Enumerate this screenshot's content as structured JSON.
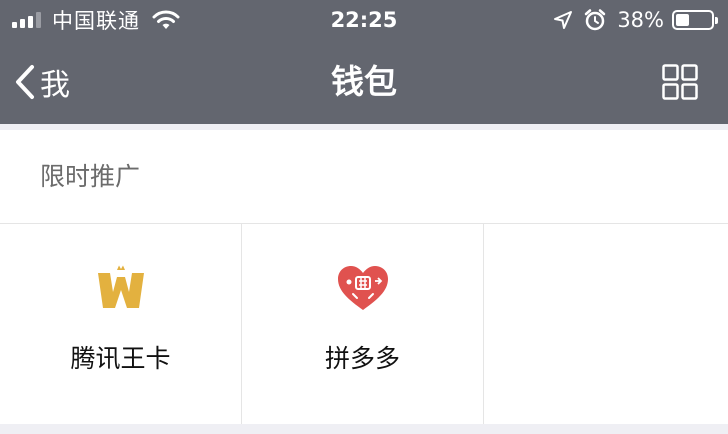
{
  "status_bar": {
    "carrier": "中国联通",
    "time": "22:25",
    "battery_percent": "38%",
    "battery_level": 0.38,
    "icons": [
      "signal-icon",
      "wifi-icon",
      "location-arrow-icon",
      "alarm-icon",
      "battery-icon"
    ]
  },
  "nav": {
    "back_label": "我",
    "title": "钱包",
    "icons": [
      "chevron-left-icon",
      "grid-icon"
    ]
  },
  "section": {
    "title": "限时推广",
    "tiles": [
      {
        "label": "腾讯王卡",
        "icon": "tencent-wangka-logo-icon",
        "color": "#e3b13f"
      },
      {
        "label": "拼多多",
        "icon": "pinduoduo-heart-logo-icon",
        "color": "#e0524f"
      }
    ]
  },
  "colors": {
    "header_bg": "#63666f",
    "page_bg": "#efeff4"
  }
}
